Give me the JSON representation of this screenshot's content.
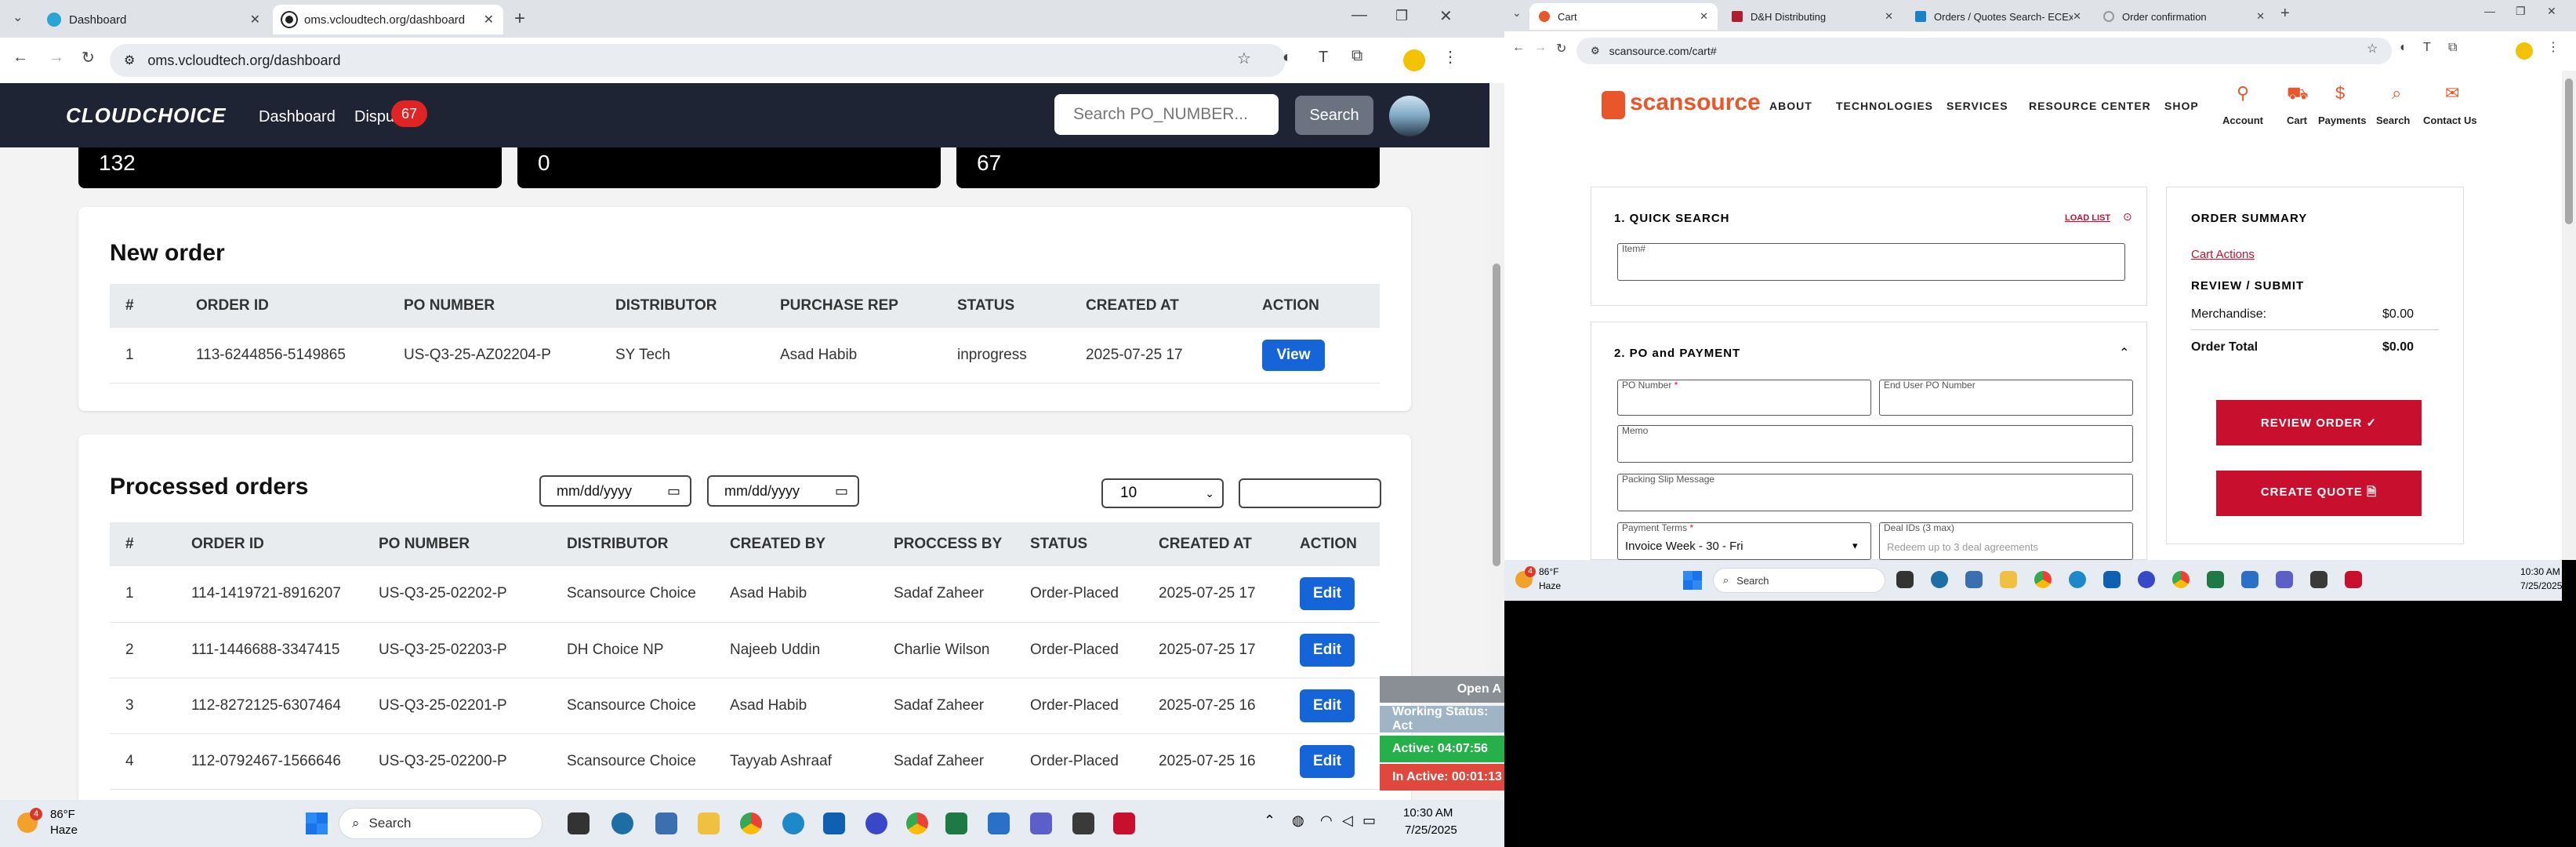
{
  "left_browser": {
    "tabs": [
      {
        "title": "Dashboard"
      },
      {
        "title": "oms.vcloudtech.org/dashboard"
      }
    ],
    "url": "oms.vcloudtech.org/dashboard"
  },
  "oms": {
    "logo": "CLOUDCHOICE",
    "nav": {
      "dashboard": "Dashboard",
      "disputes": "Dispu",
      "disputes_badge": "67"
    },
    "search": {
      "placeholder": "Search PO_NUMBER...",
      "button": "Search"
    },
    "stats": [
      "132",
      "0",
      "67"
    ],
    "new_order": {
      "title": "New order",
      "columns": [
        "#",
        "ORDER ID",
        "PO NUMBER",
        "DISTRIBUTOR",
        "PURCHASE REP",
        "STATUS",
        "CREATED AT",
        "ACTION"
      ],
      "rows": [
        {
          "num": "1",
          "order_id": "113-6244856-5149865",
          "po": "US-Q3-25-AZ02204-P",
          "distributor": "SY Tech",
          "rep": "Asad Habib",
          "status": "inprogress",
          "created": "2025-07-25 17",
          "action": "View"
        }
      ]
    },
    "processed": {
      "title": "Processed orders",
      "date_placeholder_1": "mm/dd/yyyy",
      "date_placeholder_2": "mm/dd/yyyy",
      "page_size": "10",
      "columns": [
        "#",
        "ORDER ID",
        "PO NUMBER",
        "DISTRIBUTOR",
        "CREATED BY",
        "PROCCESS BY",
        "STATUS",
        "CREATED AT",
        "ACTION"
      ],
      "rows": [
        {
          "num": "1",
          "order_id": "114-1419721-8916207",
          "po": "US-Q3-25-02202-P",
          "distributor": "Scansource Choice",
          "created_by": "Asad Habib",
          "process_by": "Sadaf Zaheer",
          "status": "Order-Placed",
          "created": "2025-07-25 17",
          "action": "Edit"
        },
        {
          "num": "2",
          "order_id": "111-1446688-3347415",
          "po": "US-Q3-25-02203-P",
          "distributor": "DH Choice NP",
          "created_by": "Najeeb Uddin",
          "process_by": "Charlie Wilson",
          "status": "Order-Placed",
          "created": "2025-07-25 17",
          "action": "Edit"
        },
        {
          "num": "3",
          "order_id": "112-8272125-6307464",
          "po": "US-Q3-25-02201-P",
          "distributor": "Scansource Choice",
          "created_by": "Asad Habib",
          "process_by": "Sadaf Zaheer",
          "status": "Order-Placed",
          "created": "2025-07-25 16",
          "action": "Edit"
        },
        {
          "num": "4",
          "order_id": "112-0792467-1566646",
          "po": "US-Q3-25-02200-P",
          "distributor": "Scansource Choice",
          "created_by": "Tayyab Ashraaf",
          "process_by": "Sadaf Zaheer",
          "status": "Order-Placed",
          "created": "2025-07-25 16",
          "action": "Edit"
        }
      ]
    },
    "work_panel": {
      "open": "Open A",
      "working": "Working Status: Act",
      "active": "Active: 04:07:56",
      "inactive": "In Active: 00:01:13"
    }
  },
  "left_taskbar": {
    "weather_temp": "86°F",
    "weather_desc": "Haze",
    "weather_badge": "4",
    "search": "Search",
    "time": "10:30 AM",
    "date": "7/25/2025"
  },
  "right_browser": {
    "tabs": [
      {
        "title": "Cart"
      },
      {
        "title": "D&H Distributing"
      },
      {
        "title": "Orders / Quotes Search- ECExp"
      },
      {
        "title": "Order confirmation"
      }
    ],
    "url": "scansource.com/cart#"
  },
  "scansource": {
    "logo": "scansource",
    "nav": [
      "ABOUT",
      "TECHNOLOGIES",
      "SERVICES",
      "RESOURCE CENTER",
      "SHOP"
    ],
    "header_icons": [
      "Account",
      "Cart",
      "Payments",
      "Search",
      "Contact Us"
    ],
    "quick_search": {
      "title": "1. QUICK SEARCH",
      "load_list": "LOAD LIST",
      "item_label": "Item#"
    },
    "po_payment": {
      "title": "2. PO and PAYMENT",
      "po_number": "PO Number",
      "end_user_po": "End User PO Number",
      "memo": "Memo",
      "packing": "Packing Slip Message",
      "payment_terms": "Payment Terms",
      "payment_value": "Invoice Week - 30 - Fri",
      "deal_ids": "Deal IDs (3 max)",
      "deal_placeholder": "Redeem up to 3 deal agreements"
    },
    "summary": {
      "title": "ORDER SUMMARY",
      "cart_actions": "Cart Actions",
      "review_title": "REVIEW / SUBMIT",
      "merch_label": "Merchandise:",
      "merch_value": "$0.00",
      "total_label": "Order Total",
      "total_value": "$0.00",
      "review_btn": "REVIEW ORDER ✓",
      "quote_btn": "CREATE QUOTE 🗎"
    }
  },
  "right_taskbar": {
    "weather_temp": "86°F",
    "weather_desc": "Haze",
    "weather_badge": "4",
    "search": "Search",
    "time": "10:30 AM",
    "date": "7/25/2025"
  }
}
